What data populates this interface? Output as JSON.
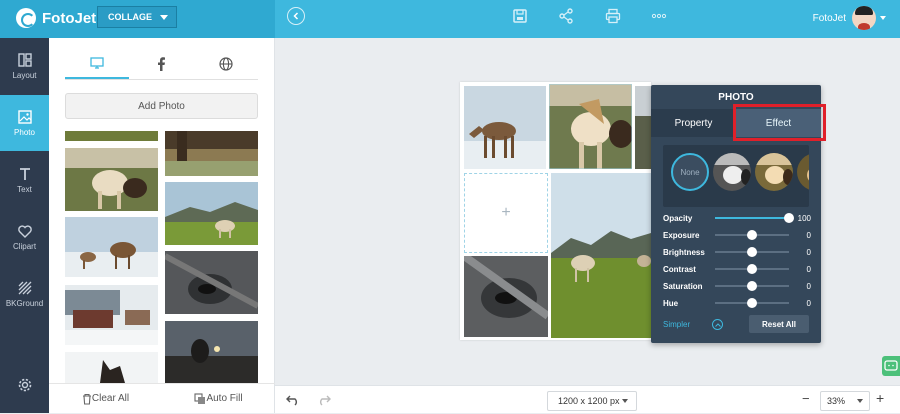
{
  "app": {
    "name": "FotoJet",
    "mode": "COLLAGE",
    "user": "FotoJet"
  },
  "sidebar": {
    "items": [
      {
        "label": "Layout",
        "icon": "layout-icon"
      },
      {
        "label": "Photo",
        "icon": "photo-icon",
        "active": true
      },
      {
        "label": "Text",
        "icon": "text-icon"
      },
      {
        "label": "Clipart",
        "icon": "heart-icon"
      },
      {
        "label": "BKGround",
        "icon": "background-icon"
      },
      {
        "label": "",
        "icon": "gear-icon"
      }
    ]
  },
  "panel": {
    "tabs": [
      {
        "icon": "computer-icon",
        "active": true
      },
      {
        "icon": "facebook-icon"
      },
      {
        "icon": "globe-icon"
      }
    ],
    "add_photo": "Add Photo",
    "clear_all": "Clear All",
    "auto_fill": "Auto Fill"
  },
  "canvas": {
    "empty_cell_symbol": "+"
  },
  "photo_panel": {
    "title": "PHOTO",
    "tabs": {
      "property": "Property",
      "effect": "Effect"
    },
    "filter_none": "None",
    "sliders": [
      {
        "label": "Opacity",
        "value": "100",
        "level": 1.0
      },
      {
        "label": "Exposure",
        "value": "0",
        "level": 0.5
      },
      {
        "label": "Brightness",
        "value": "0",
        "level": 0.5
      },
      {
        "label": "Contrast",
        "value": "0",
        "level": 0.5
      },
      {
        "label": "Saturation",
        "value": "0",
        "level": 0.5
      },
      {
        "label": "Hue",
        "value": "0",
        "level": 0.5
      }
    ],
    "simpler": "Simpler",
    "reset_all": "Reset All"
  },
  "bottom": {
    "size": "1200 x 1200 px",
    "zoom": "33%",
    "zoom_out": "−",
    "zoom_in": "+"
  },
  "colors": {
    "accent": "#3eb8de",
    "sidebar": "#2e3b4e",
    "panel": "#34475a",
    "highlight": "#e0202a"
  }
}
